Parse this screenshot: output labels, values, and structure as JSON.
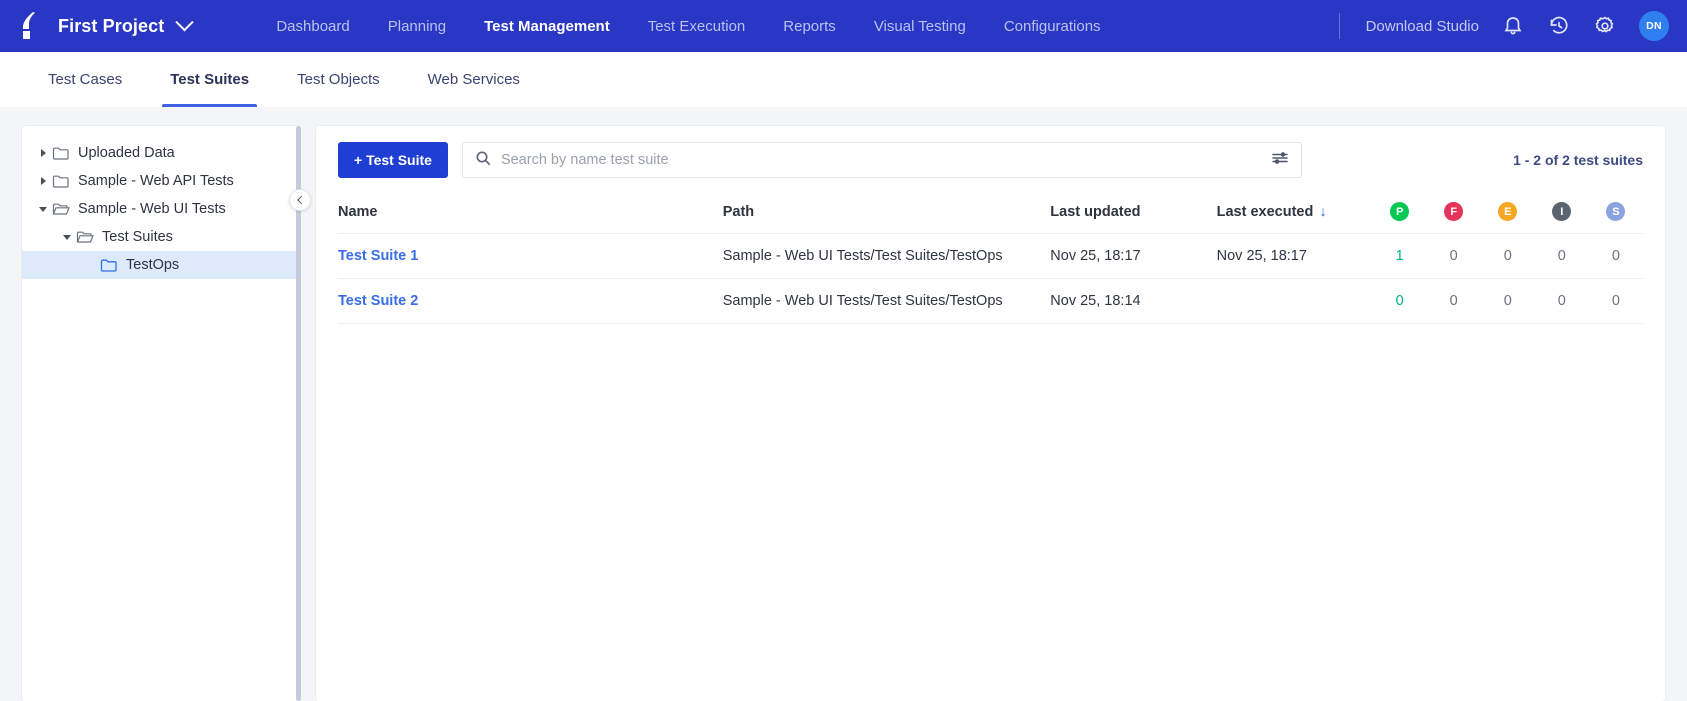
{
  "topnav": {
    "brand": "First Project",
    "logo_icon": "katalon-logo-icon",
    "project_chevron_icon": "chevron-down-icon",
    "links": [
      {
        "label": "Dashboard",
        "active": false
      },
      {
        "label": "Planning",
        "active": false
      },
      {
        "label": "Test Management",
        "active": true
      },
      {
        "label": "Test Execution",
        "active": false
      },
      {
        "label": "Reports",
        "active": false
      },
      {
        "label": "Visual Testing",
        "active": false
      },
      {
        "label": "Configurations",
        "active": false
      }
    ],
    "download_studio": "Download Studio",
    "icons": [
      "bell-icon",
      "history-icon",
      "gear-icon"
    ],
    "avatar_initials": "DN",
    "bg_color": "#2a36c4",
    "avatar_color": "#2f7ff0"
  },
  "subtabs": [
    {
      "label": "Test Cases",
      "active": false
    },
    {
      "label": "Test Suites",
      "active": true
    },
    {
      "label": "Test Objects",
      "active": false
    },
    {
      "label": "Web Services",
      "active": false
    }
  ],
  "sidebar": {
    "collapse_icon": "chevron-left-icon",
    "tree": [
      {
        "label": "Uploaded Data",
        "indent": 0,
        "state": "closed",
        "folder": "folder-closed-icon",
        "selected": false
      },
      {
        "label": "Sample - Web API Tests",
        "indent": 0,
        "state": "closed",
        "folder": "folder-closed-icon",
        "selected": false
      },
      {
        "label": "Sample - Web UI Tests",
        "indent": 0,
        "state": "open",
        "folder": "folder-open-icon",
        "selected": false
      },
      {
        "label": "Test Suites",
        "indent": 1,
        "state": "open",
        "folder": "folder-open-icon",
        "selected": false
      },
      {
        "label": "TestOps",
        "indent": 2,
        "state": "leaf",
        "folder": "folder-closed-icon",
        "selected": true
      }
    ]
  },
  "toolbar": {
    "add_button": "+ Test Suite",
    "search_placeholder": "Search by name test suite",
    "search_value": "",
    "search_icon": "search-icon",
    "filter_icon": "filter-sliders-icon",
    "count_text": "1 - 2 of 2 test suites"
  },
  "table": {
    "headers": {
      "name": "Name",
      "path": "Path",
      "last_updated": "Last updated",
      "last_executed": "Last executed",
      "sort_arrow": "↓"
    },
    "status_headers": [
      {
        "letter": "P",
        "name": "passed",
        "color": "#00c853"
      },
      {
        "letter": "F",
        "name": "failed",
        "color": "#e5345a"
      },
      {
        "letter": "E",
        "name": "error",
        "color": "#f5a623"
      },
      {
        "letter": "I",
        "name": "incomplete",
        "color": "#5b6570"
      },
      {
        "letter": "S",
        "name": "skipped",
        "color": "#8aa3e0"
      }
    ],
    "rows": [
      {
        "name": "Test Suite 1",
        "path": "Sample - Web UI Tests/Test Suites/TestOps",
        "last_updated": "Nov 25, 18:17",
        "last_executed": "Nov 25, 18:17",
        "passed": "1",
        "failed": "0",
        "error": "0",
        "incomplete": "0",
        "skipped": "0"
      },
      {
        "name": "Test Suite 2",
        "path": "Sample - Web UI Tests/Test Suites/TestOps",
        "last_updated": "Nov 25, 18:14",
        "last_executed": "",
        "passed": "0",
        "failed": "0",
        "error": "0",
        "incomplete": "0",
        "skipped": "0"
      }
    ]
  }
}
